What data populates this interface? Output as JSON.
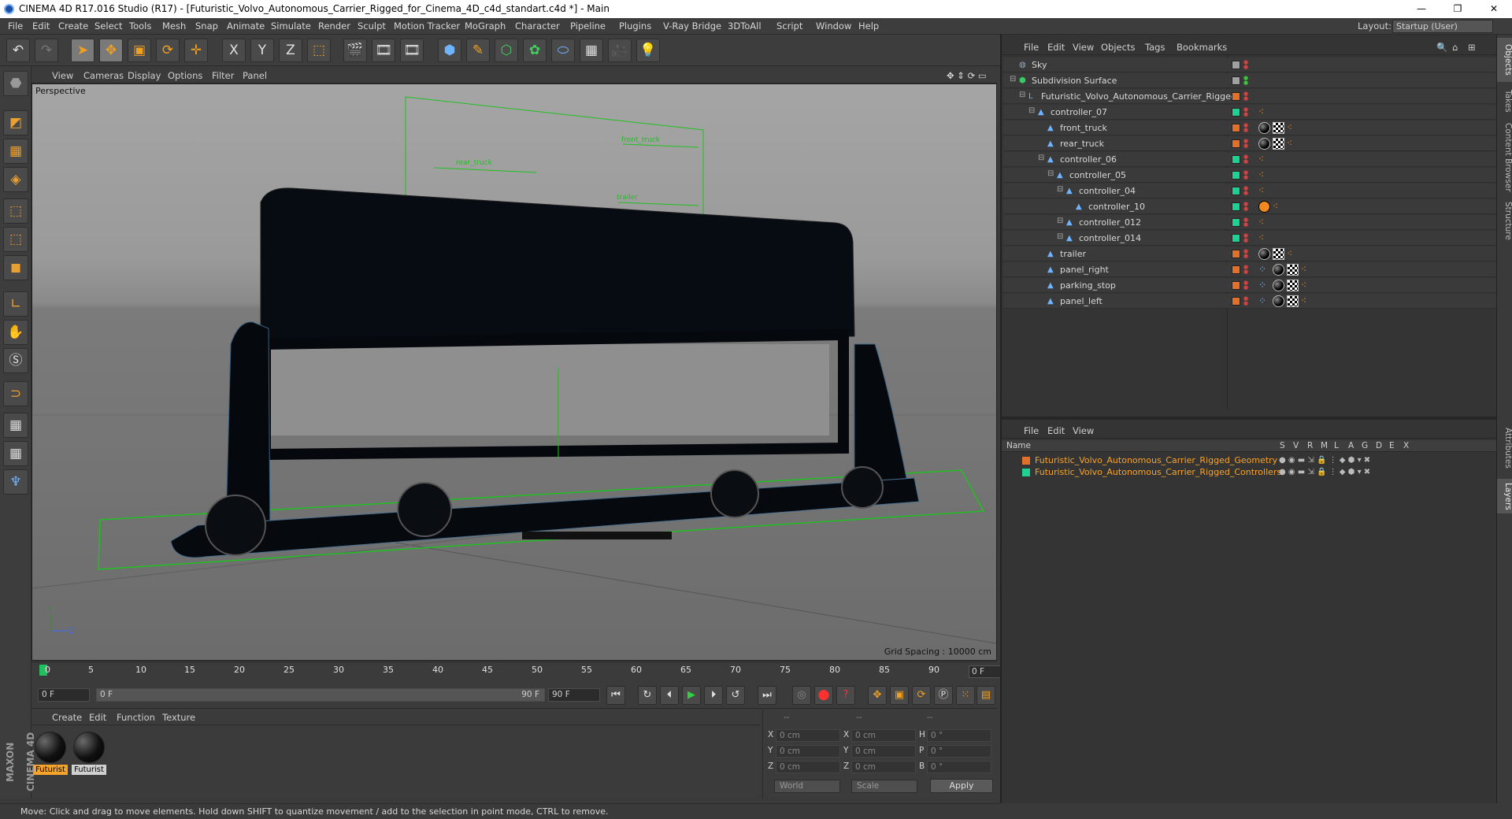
{
  "window": {
    "title": "CINEMA 4D R17.016 Studio (R17) - [Futuristic_Volvo_Autonomous_Carrier_Rigged_for_Cinema_4D_c4d_standart.c4d *] - Main",
    "minimize": "—",
    "maximize": "❐",
    "close": "✕"
  },
  "menubar": {
    "items": [
      "File",
      "Edit",
      "Create",
      "Select",
      "Tools",
      "Mesh",
      "Snap",
      "Animate",
      "Simulate",
      "Render",
      "Sculpt",
      "Motion Tracker",
      "MoGraph",
      "Character",
      "Pipeline",
      "Plugins",
      "V-Ray Bridge",
      "3DToAll",
      "Script",
      "Window",
      "Help"
    ],
    "layout_label": "Layout:",
    "layout_value": "Startup (User)"
  },
  "toolbar": {
    "icons": [
      "↶",
      "↷",
      "➤",
      "✥",
      "▣",
      "⟳",
      "✛",
      "X",
      "Y",
      "Z",
      "⬚",
      "🎬",
      "🎞",
      "🎞",
      "⬢",
      "✎",
      "⬡",
      "✿",
      "⬭",
      "▦",
      "🎥",
      "💡"
    ]
  },
  "viewport": {
    "menu": [
      "View",
      "Cameras",
      "Display",
      "Options",
      "Filter",
      "Panel"
    ],
    "label": "Perspective",
    "grid_spacing": "Grid Spacing : 10000 cm",
    "annotations": [
      "rear_truck",
      "front_truck",
      "trailer"
    ]
  },
  "timeline": {
    "ticks": [
      "0",
      "5",
      "10",
      "15",
      "20",
      "25",
      "30",
      "35",
      "40",
      "45",
      "50",
      "55",
      "60",
      "65",
      "70",
      "75",
      "80",
      "85",
      "90"
    ],
    "frame_end": "0 F"
  },
  "transport": {
    "current": "0 F",
    "range_start": "0 F",
    "range_end": "90 F",
    "max": "90 F"
  },
  "materials": {
    "menu": [
      "Create",
      "Edit",
      "Function",
      "Texture"
    ],
    "items": [
      {
        "label": "Futurist",
        "active": true
      },
      {
        "label": "Futurist",
        "active": false
      }
    ]
  },
  "coords": {
    "header": [
      "--",
      "--",
      "--"
    ],
    "rows": [
      {
        "a": "X",
        "av": "0 cm",
        "b": "X",
        "bv": "0 cm",
        "c": "H",
        "cv": "0 °"
      },
      {
        "a": "Y",
        "av": "0 cm",
        "b": "Y",
        "bv": "0 cm",
        "c": "P",
        "cv": "0 °"
      },
      {
        "a": "Z",
        "av": "0 cm",
        "b": "Z",
        "bv": "0 cm",
        "c": "B",
        "cv": "0 °"
      }
    ],
    "space": "World",
    "mode": "Scale",
    "apply": "Apply"
  },
  "status": "Move: Click and drag to move elements. Hold down SHIFT to quantize movement / add to the selection in point mode, CTRL to remove.",
  "maxon": "MAXON CINEMA 4D",
  "objects": {
    "menu": [
      "File",
      "Edit",
      "View",
      "Objects",
      "Tags",
      "Bookmarks"
    ],
    "rows": [
      {
        "name": "Sky",
        "indent": 0,
        "color": "#a0a0a0"
      },
      {
        "name": "Subdivision Surface",
        "indent": 0,
        "color": "#a0a0a0"
      },
      {
        "name": "Futuristic_Volvo_Autonomous_Carrier_Rigged",
        "indent": 1,
        "color": "#e0702a"
      },
      {
        "name": "controller_07",
        "indent": 2,
        "color": "#20d090"
      },
      {
        "name": "front_truck",
        "indent": 3,
        "color": "#e0702a"
      },
      {
        "name": "rear_truck",
        "indent": 3,
        "color": "#e0702a"
      },
      {
        "name": "controller_06",
        "indent": 3,
        "color": "#20d090"
      },
      {
        "name": "controller_05",
        "indent": 4,
        "color": "#20d090"
      },
      {
        "name": "controller_04",
        "indent": 5,
        "color": "#20d090"
      },
      {
        "name": "controller_10",
        "indent": 6,
        "color": "#20d090"
      },
      {
        "name": "controller_012",
        "indent": 5,
        "color": "#20d090"
      },
      {
        "name": "controller_014",
        "indent": 5,
        "color": "#20d090"
      },
      {
        "name": "trailer",
        "indent": 3,
        "color": "#e0702a"
      },
      {
        "name": "panel_right",
        "indent": 3,
        "color": "#e0702a"
      },
      {
        "name": "parking_stop",
        "indent": 3,
        "color": "#e0702a"
      },
      {
        "name": "panel_left",
        "indent": 3,
        "color": "#e0702a"
      }
    ]
  },
  "layers": {
    "menu": [
      "File",
      "Edit",
      "View"
    ],
    "header_name": "Name",
    "columns": [
      "S",
      "V",
      "R",
      "M",
      "L",
      "A",
      "G",
      "D",
      "E",
      "X"
    ],
    "rows": [
      {
        "name": "Futuristic_Volvo_Autonomous_Carrier_Rigged_Geometry",
        "color": "#e0702a"
      },
      {
        "name": "Futuristic_Volvo_Autonomous_Carrier_Rigged_Controllers",
        "color": "#20d090"
      }
    ]
  },
  "sidetabs": [
    "Objects",
    "Takes",
    "Content Browser",
    "Structure",
    "Attributes",
    "Layers"
  ]
}
